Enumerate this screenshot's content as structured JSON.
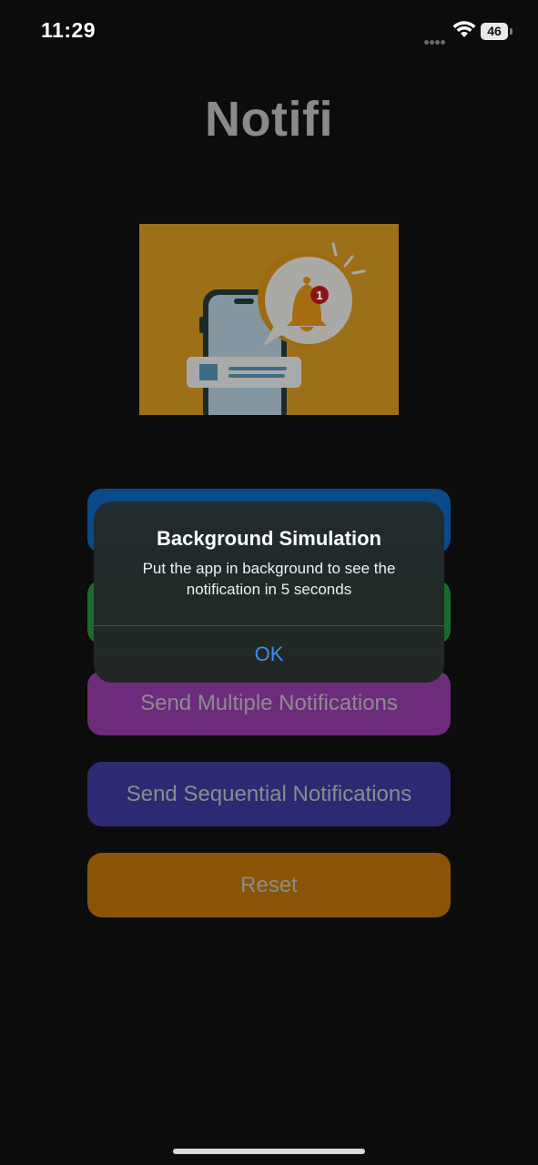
{
  "status_bar": {
    "time": "11:29",
    "battery": "46"
  },
  "app": {
    "title": "Notifi"
  },
  "hero_image": {
    "badge_count": "1"
  },
  "buttons": [
    {
      "label": ""
    },
    {
      "label": ""
    },
    {
      "label": "Send Multiple Notifications"
    },
    {
      "label": "Send Sequential Notifications"
    },
    {
      "label": "Reset"
    }
  ],
  "alert": {
    "title": "Background Simulation",
    "message": "Put the app in background to see the notification in 5 seconds",
    "ok_label": "OK"
  },
  "colors": {
    "blue": "#0a4a8a",
    "green": "#1b6b2c",
    "purple": "#6c2c7b",
    "indigo": "#2c2a72",
    "orange": "#8a5407",
    "accent": "#3d8ef0"
  }
}
